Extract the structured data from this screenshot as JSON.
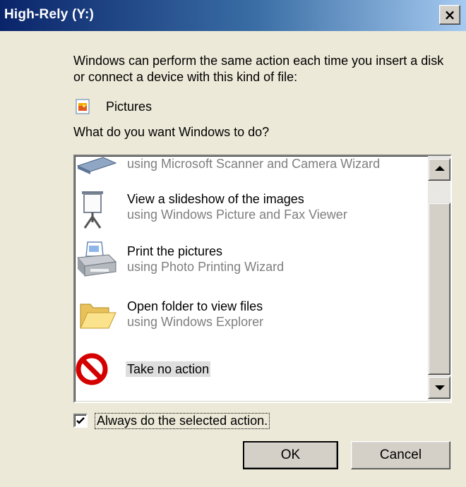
{
  "window": {
    "title": "High-Rely (Y:)",
    "close_symbol": "×"
  },
  "intro_text": "Windows can perform the same action each time you insert a disk or connect a device with this kind of file:",
  "content_type": {
    "label": "Pictures",
    "icon": "pictures-icon"
  },
  "question": "What do you want Windows to do?",
  "actions": [
    {
      "partial_sub": "using Microsoft Scanner and Camera Wizard",
      "icon": "scanner-icon"
    },
    {
      "label": "View a slideshow of the images",
      "sub": "using Windows Picture and Fax Viewer",
      "icon": "slideshow-icon"
    },
    {
      "label": "Print the pictures",
      "sub": "using Photo Printing Wizard",
      "icon": "printer-icon"
    },
    {
      "label": "Open folder to view files",
      "sub": "using Windows Explorer",
      "icon": "folder-icon"
    },
    {
      "label": "Take no action",
      "icon": "no-action-icon",
      "selected": true
    }
  ],
  "always_checkbox": {
    "label": "Always do the selected action.",
    "checked": true
  },
  "buttons": {
    "ok": "OK",
    "cancel": "Cancel"
  },
  "colors": {
    "title_gradient_start": "#0a246a",
    "title_gradient_end": "#a6caf0",
    "dialog_bg": "#ece9d8",
    "secondary_text": "#7f7f7f",
    "no_action_red": "#d40000"
  }
}
